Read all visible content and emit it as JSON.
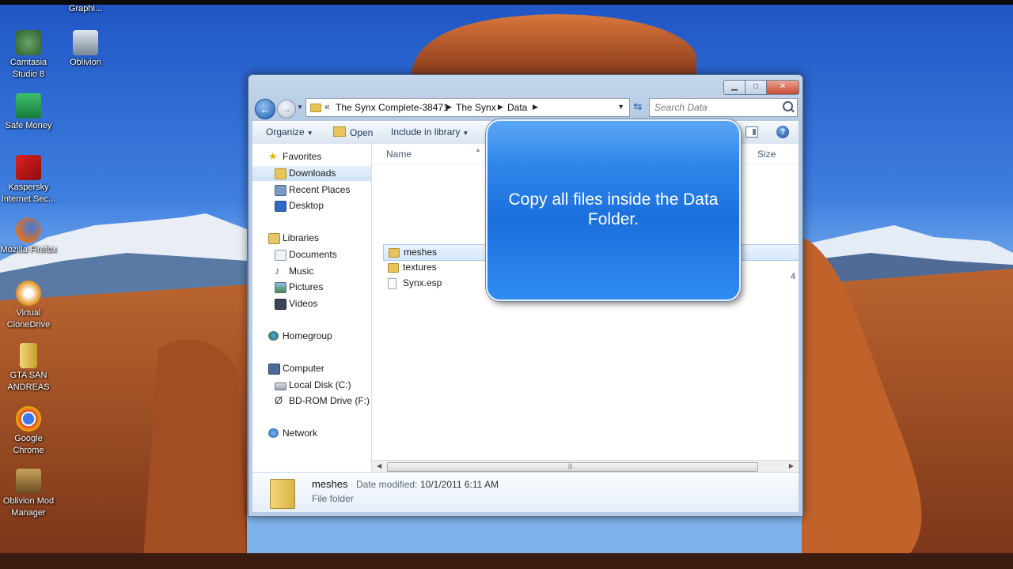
{
  "desktop": {
    "icons": [
      {
        "label": "Graphi..."
      },
      {
        "label": "Camtasia Studio 8"
      },
      {
        "label": "Oblivion"
      },
      {
        "label": "Safe Money"
      },
      {
        "label": "Kaspersky Internet Sec..."
      },
      {
        "label": "Mozilla Firefox"
      },
      {
        "label": "Virtual CloneDrive"
      },
      {
        "label": "GTA SAN ANDREAS"
      },
      {
        "label": "Google Chrome"
      },
      {
        "label": "Oblivion Mod Manager"
      }
    ]
  },
  "window": {
    "address": {
      "overflow": "«",
      "crumbs": [
        "The Synx Complete-38471",
        "The Synx",
        "Data"
      ]
    },
    "search": {
      "placeholder": "Search Data"
    },
    "toolbar": {
      "organize": "Organize",
      "open": "Open",
      "include": "Include in library"
    },
    "nav": {
      "favorites": "Favorites",
      "downloads": "Downloads",
      "recent": "Recent Places",
      "desktop": "Desktop",
      "libraries": "Libraries",
      "documents": "Documents",
      "music": "Music",
      "pictures": "Pictures",
      "videos": "Videos",
      "homegroup": "Homegroup",
      "computer": "Computer",
      "local_disk": "Local Disk (C:)",
      "bd_rom": "BD-ROM Drive (F:) O",
      "network": "Network"
    },
    "columns": {
      "name": "Name",
      "size": "Size"
    },
    "files": [
      {
        "name": "meshes",
        "type": "folder"
      },
      {
        "name": "textures",
        "type": "folder"
      },
      {
        "name": "Synx.esp",
        "type": "file"
      }
    ],
    "size_value": "4",
    "details": {
      "name": "meshes",
      "modified_label": "Date modified:",
      "modified_value": "10/1/2011 6:11 AM",
      "type": "File folder"
    }
  },
  "callout": {
    "text": "Copy all files inside the Data Folder."
  }
}
